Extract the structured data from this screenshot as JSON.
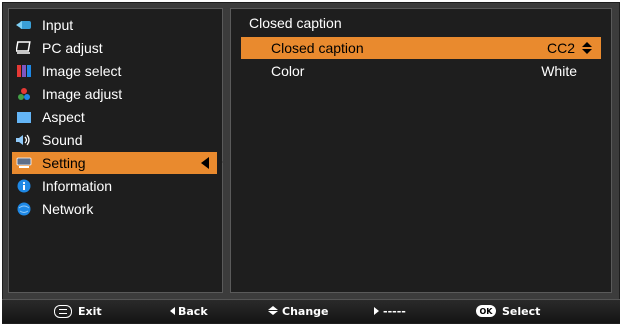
{
  "sidebar": {
    "items": [
      {
        "label": "Input",
        "icon": "input-icon"
      },
      {
        "label": "PC adjust",
        "icon": "pc-adjust-icon"
      },
      {
        "label": "Image select",
        "icon": "image-select-icon"
      },
      {
        "label": "Image adjust",
        "icon": "image-adjust-icon"
      },
      {
        "label": "Aspect",
        "icon": "aspect-icon"
      },
      {
        "label": "Sound",
        "icon": "sound-icon"
      },
      {
        "label": "Setting",
        "icon": "setting-icon",
        "active": true
      },
      {
        "label": "Information",
        "icon": "information-icon"
      },
      {
        "label": "Network",
        "icon": "network-icon"
      }
    ]
  },
  "panel": {
    "title": "Closed caption",
    "rows": [
      {
        "label": "Closed caption",
        "value": "CC2",
        "selected": true
      },
      {
        "label": "Color",
        "value": "White",
        "selected": false
      }
    ]
  },
  "footer": {
    "exit": "Exit",
    "back": "Back",
    "change": "Change",
    "next": "-----",
    "select": "Select",
    "ok_badge": "OK"
  },
  "colors": {
    "highlight": "#e98a2e",
    "panel_bg": "#1e1e1e",
    "frame_bg": "#3c3c3c"
  }
}
